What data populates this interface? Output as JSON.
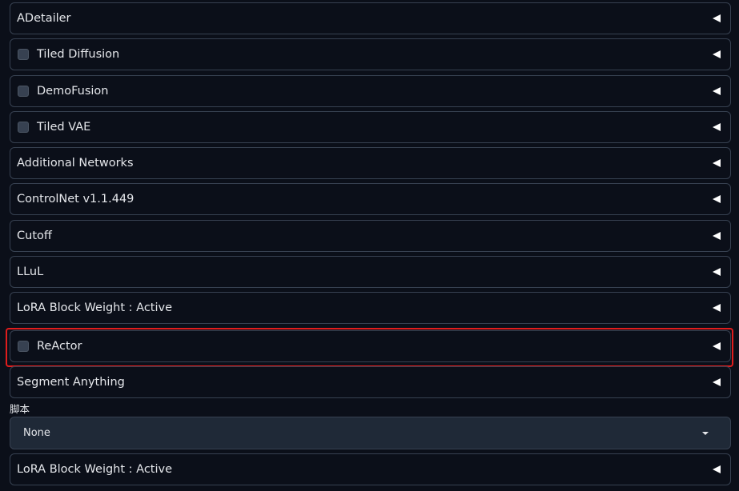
{
  "accordions": [
    {
      "label": "ADetailer",
      "checkbox": false
    },
    {
      "label": "Tiled Diffusion",
      "checkbox": true
    },
    {
      "label": "DemoFusion",
      "checkbox": true
    },
    {
      "label": "Tiled VAE",
      "checkbox": true
    },
    {
      "label": "Additional Networks",
      "checkbox": false
    },
    {
      "label": "ControlNet v1.1.449",
      "checkbox": false
    },
    {
      "label": "Cutoff",
      "checkbox": false
    },
    {
      "label": "LLuL",
      "checkbox": false
    },
    {
      "label": "LoRA Block Weight : Active",
      "checkbox": false
    },
    {
      "label": "ReActor",
      "checkbox": true,
      "highlighted": true
    },
    {
      "label": "Segment Anything",
      "checkbox": false
    }
  ],
  "script": {
    "label": "脚本",
    "selected": "None"
  },
  "bottom_accordion": {
    "label": "LoRA Block Weight : Active"
  },
  "colors": {
    "background": "#0b0f19",
    "border": "#374151",
    "highlight": "#e11d1d",
    "dropdown_bg": "#1f2937"
  },
  "icons": {
    "toggle": "collapse-triangle-left-icon",
    "dropdown": "caret-down-icon"
  }
}
